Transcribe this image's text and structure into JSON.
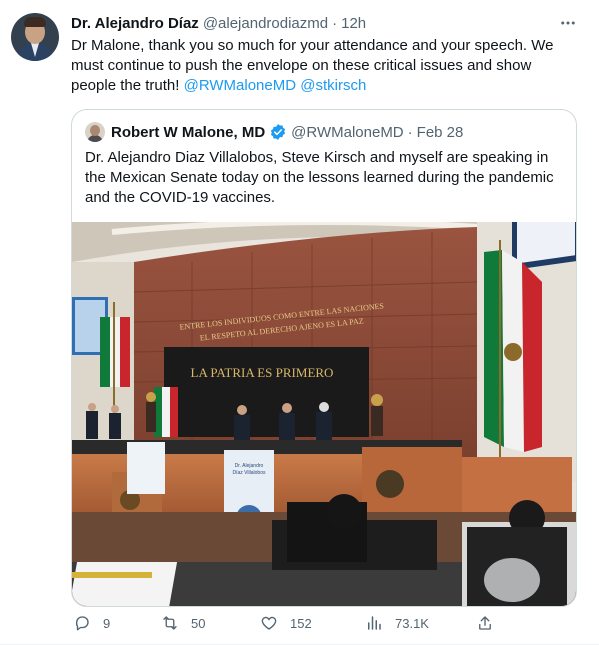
{
  "tweet": {
    "author_name": "Dr. Alejandro Díaz",
    "author_handle": "@alejandrodiazmd",
    "separator": "·",
    "time": "12h",
    "more_icon": "more-horizontal-icon",
    "text": "Dr Malone, thank you so much for your attendance and your speech. We must continue to push the envelope on these critical issues and show people the truth! ",
    "mentions": [
      "@RWMaloneMD",
      "@stkirsch"
    ]
  },
  "quote": {
    "author_name": "Robert W Malone, MD",
    "author_handle": "@RWMaloneMD",
    "separator": "·",
    "date": "Feb 28",
    "text": "Dr. Alejandro Diaz Villalobos, Steve Kirsch and myself are speaking in the Mexican Senate today on the lessons learned during the pandemic and the COVID-19 vaccines.",
    "photo": {
      "wall_inscription_line1": "ENTRE LOS INDIVIDUOS COMO ENTRE LAS NACIONES",
      "wall_inscription_line2": "EL RESPETO AL DERECHO AJENO ES LA PAZ",
      "banner_text": "LA PATRIA ES PRIMERO",
      "banner_small_1": "Dr. Alejandro",
      "banner_small_2": "Díaz Villalobos"
    }
  },
  "actions": {
    "reply_count": "9",
    "retweet_count": "50",
    "like_count": "152",
    "views_count": "73.1K"
  },
  "colors": {
    "link": "#1d9bf0",
    "secondary_text": "#536471",
    "verified": "#1d9bf0",
    "border": "#cfd9de"
  }
}
